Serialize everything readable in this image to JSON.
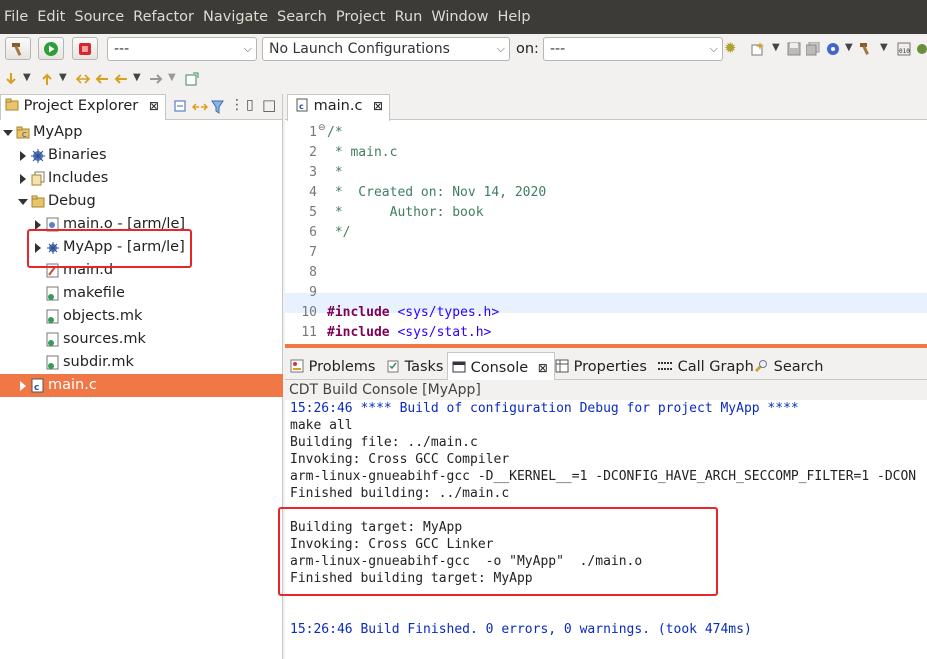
{
  "menubar": {
    "items": [
      "File",
      "Edit",
      "Source",
      "Refactor",
      "Navigate",
      "Search",
      "Project",
      "Run",
      "Window",
      "Help"
    ]
  },
  "toolbar": {
    "mode_combo_value": "---",
    "launch_config_value": "No Launch Configurations",
    "on_label": "on:",
    "target_combo_value": "---"
  },
  "project_explorer": {
    "tab_label": "Project Explorer",
    "close_glyph": "⊠",
    "tree": [
      {
        "label": "MyApp",
        "icon": "project-icon"
      },
      {
        "label": "Binaries",
        "icon": "binaries-icon"
      },
      {
        "label": "Includes",
        "icon": "includes-icon"
      },
      {
        "label": "Debug",
        "icon": "folder-icon"
      },
      {
        "label": "main.o - [arm/le]",
        "icon": "object-file-icon"
      },
      {
        "label": "MyApp - [arm/le]",
        "icon": "executable-icon"
      },
      {
        "label": "main.d",
        "icon": "file-icon"
      },
      {
        "label": "makefile",
        "icon": "makefile-icon"
      },
      {
        "label": "objects.mk",
        "icon": "makefile-icon"
      },
      {
        "label": "sources.mk",
        "icon": "makefile-icon"
      },
      {
        "label": "subdir.mk",
        "icon": "makefile-icon"
      },
      {
        "label": "main.c",
        "icon": "c-source-icon"
      }
    ]
  },
  "editor": {
    "tab_label": "main.c",
    "lines": [
      {
        "n": "1",
        "text": "/*"
      },
      {
        "n": "2",
        "text": " * main.c"
      },
      {
        "n": "3",
        "text": " *"
      },
      {
        "n": "4",
        "text": " *  Created on: Nov 14, 2020"
      },
      {
        "n": "5",
        "text": " *      Author: book"
      },
      {
        "n": "6",
        "text": " */"
      },
      {
        "n": "7",
        "text": ""
      },
      {
        "n": "8",
        "text": ""
      },
      {
        "n": "9",
        "text": ""
      },
      {
        "n": "10",
        "kw": "#include",
        "inc": "<sys/types.h>"
      },
      {
        "n": "11",
        "kw": "#include",
        "inc": "<sys/stat.h>"
      }
    ]
  },
  "console_panel": {
    "tabs": [
      "Problems",
      "Tasks",
      "Console",
      "Properties",
      "Call Graph",
      "Search"
    ],
    "title": "CDT Build Console [MyApp]",
    "lines": [
      "15:26:46 **** Build of configuration Debug for project MyApp ****",
      "make all",
      "Building file: ../main.c",
      "Invoking: Cross GCC Compiler",
      "arm-linux-gnueabihf-gcc -D__KERNEL__=1 -DCONFIG_HAVE_ARCH_SECCOMP_FILTER=1 -DCON",
      "Finished building: ../main.c",
      "",
      "Building target: MyApp",
      "Invoking: Cross GCC Linker",
      "arm-linux-gnueabihf-gcc  -o \"MyApp\"  ./main.o",
      "Finished building target: MyApp",
      "",
      "",
      "15:26:46 Build Finished. 0 errors, 0 warnings. (took 474ms)"
    ]
  },
  "colors": {
    "selection": "#f07746",
    "annotation_box": "#e8252b",
    "console_blue": "#0a2bbf"
  }
}
